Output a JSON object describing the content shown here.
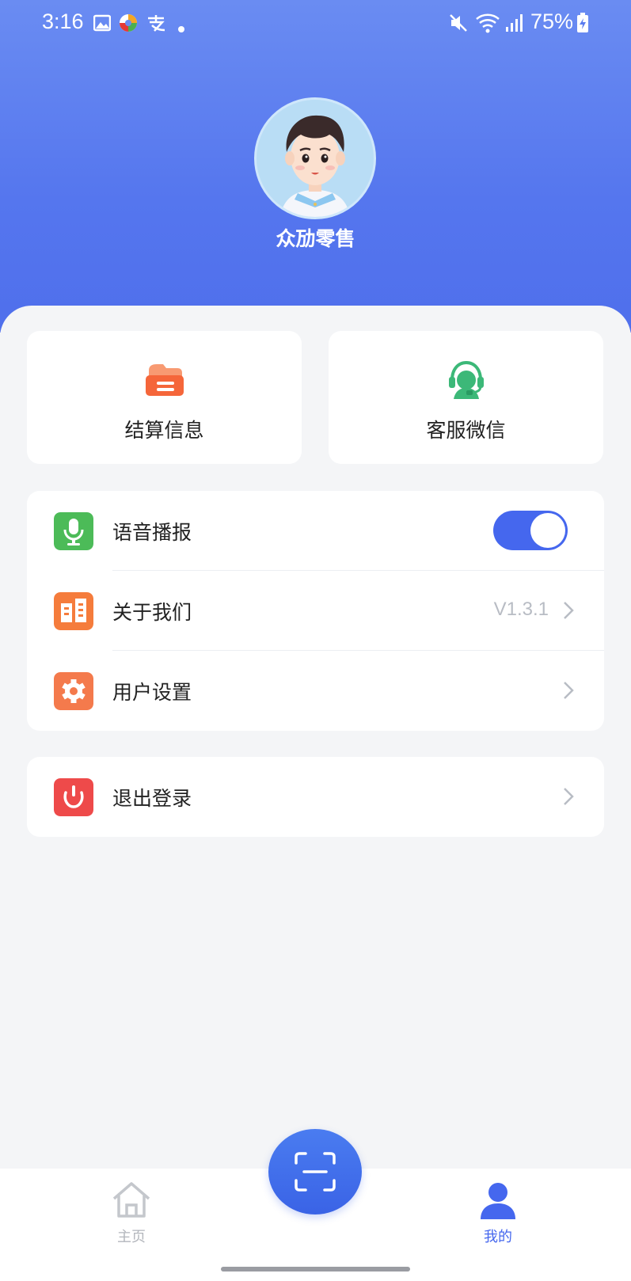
{
  "status_bar": {
    "time": "3:16",
    "battery": "75%"
  },
  "profile": {
    "name": "众劢零售"
  },
  "quick_actions": [
    {
      "label": "结算信息",
      "icon": "wallet-icon",
      "color": "#f5663a"
    },
    {
      "label": "客服微信",
      "icon": "headset-icon",
      "color": "#3cb878"
    }
  ],
  "menu": {
    "voice": {
      "label": "语音播报",
      "icon": "microphone-icon",
      "color": "#4cbb58",
      "enabled": true
    },
    "about": {
      "label": "关于我们",
      "icon": "building-icon",
      "color": "#f57c3c",
      "version": "V1.3.1"
    },
    "settings": {
      "label": "用户设置",
      "icon": "gear-icon",
      "color": "#f47a4c"
    }
  },
  "logout": {
    "label": "退出登录",
    "icon": "power-icon",
    "color": "#ee4a4a"
  },
  "tab_bar": {
    "home": "主页",
    "mine": "我的"
  },
  "colors": {
    "accent": "#4567ee",
    "header_top": "#6a8cf2",
    "header_bottom": "#4f6fec"
  }
}
